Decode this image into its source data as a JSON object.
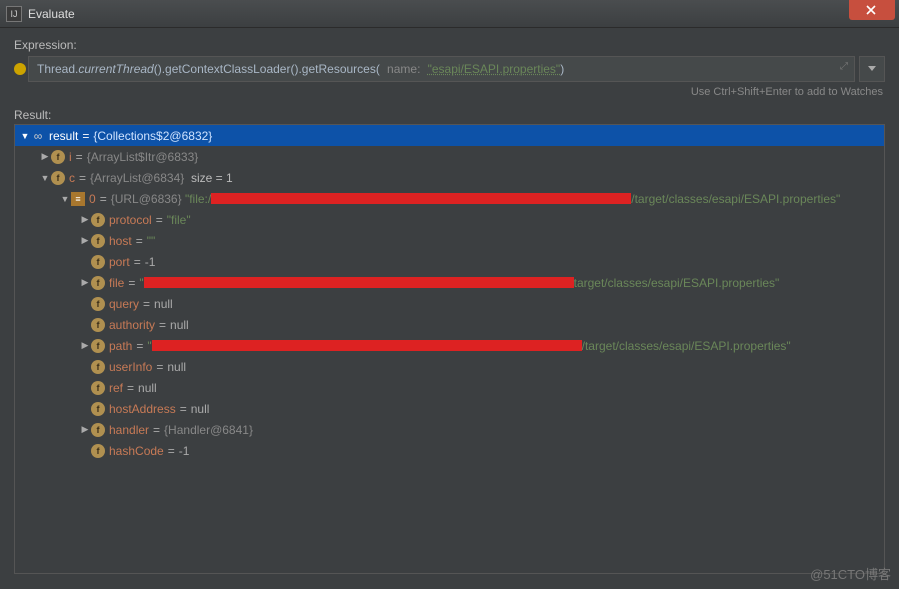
{
  "window": {
    "title": "Evaluate"
  },
  "labels": {
    "expression": "Expression:",
    "result": "Result:",
    "hint": "Use Ctrl+Shift+Enter to add to Watches"
  },
  "expression": {
    "prefix": "Thread.",
    "chain_italic": "currentThread",
    "chain_rest": "().getContextClassLoader().getResources(",
    "param_name": "name:",
    "param_value": "\"esapi/ESAPI.properties\"",
    "suffix": ")"
  },
  "tree": {
    "result": {
      "name": "result",
      "obj": "{Collections$2@6832}"
    },
    "i": {
      "name": "i",
      "obj": "{ArrayList$Itr@6833}"
    },
    "c": {
      "name": "c",
      "obj": "{ArrayList@6834}",
      "size_label": "size = 1"
    },
    "idx0": {
      "name": "0",
      "obj": "{URL@6836}",
      "val_prefix": "\"file:/",
      "val_suffix": "/target/classes/esapi/ESAPI.properties\""
    },
    "protocol": {
      "name": "protocol",
      "val": "\"file\""
    },
    "host": {
      "name": "host",
      "val": "\"\""
    },
    "port": {
      "name": "port",
      "val": "-1"
    },
    "file": {
      "name": "file",
      "val_prefix": "\"",
      "val_suffix": "target/classes/esapi/ESAPI.properties\""
    },
    "query": {
      "name": "query",
      "val": "null"
    },
    "authority": {
      "name": "authority",
      "val": "null"
    },
    "path": {
      "name": "path",
      "val_prefix": "\"",
      "val_suffix": "/target/classes/esapi/ESAPI.properties\""
    },
    "userInfo": {
      "name": "userInfo",
      "val": "null"
    },
    "ref": {
      "name": "ref",
      "val": "null"
    },
    "hostAddress": {
      "name": "hostAddress",
      "val": "null"
    },
    "handler": {
      "name": "handler",
      "obj": "{Handler@6841}"
    },
    "hashCode": {
      "name": "hashCode",
      "val": "-1"
    }
  },
  "watermark": "@51CTO博客"
}
